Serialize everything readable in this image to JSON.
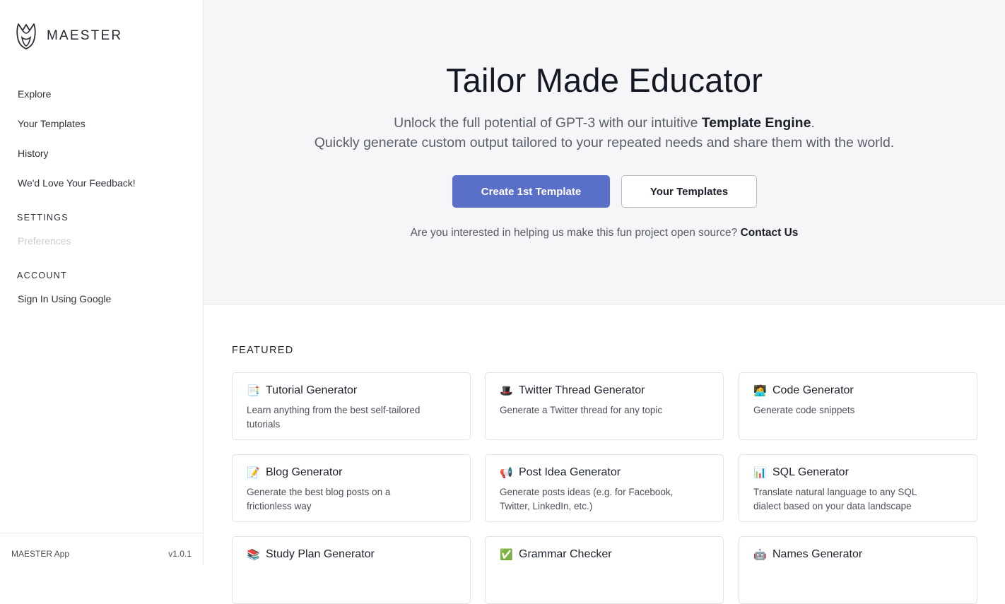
{
  "sidebar": {
    "brand": "MAESTER",
    "nav": [
      {
        "label": "Explore"
      },
      {
        "label": "Your Templates"
      },
      {
        "label": "History"
      },
      {
        "label": "We'd Love Your Feedback!"
      }
    ],
    "settings_title": "SETTINGS",
    "settings_items": [
      {
        "label": "Preferences",
        "disabled": true
      }
    ],
    "account_title": "ACCOUNT",
    "account_items": [
      {
        "label": "Sign In Using Google"
      }
    ],
    "footer": {
      "app_name": "MAESTER App",
      "version": "v1.0.1"
    }
  },
  "hero": {
    "title": "Tailor Made Educator",
    "subtitle_prefix": "Unlock the full potential of GPT-3 with our intuitive ",
    "subtitle_bold": "Template Engine",
    "subtitle_suffix": ".",
    "subtitle_line2": "Quickly generate custom output tailored to your repeated needs and share them with the world.",
    "primary_button": "Create 1st Template",
    "secondary_button": "Your Templates",
    "contact_text": "Are you interested in helping us make this fun project open source?",
    "contact_link": "Contact Us"
  },
  "featured": {
    "title": "FEATURED",
    "cards": [
      {
        "icon": "page-icon",
        "title": "Tutorial Generator",
        "description": "Learn anything from the best self-tailored tutorials"
      },
      {
        "icon": "top-hat-icon",
        "title": "Twitter Thread Generator",
        "description": "Generate a Twitter thread for any topic"
      },
      {
        "icon": "technologist-icon",
        "title": "Code Generator",
        "description": "Generate code snippets"
      },
      {
        "icon": "memo-icon",
        "title": "Blog Generator",
        "description": "Generate the best blog posts on a frictionless way"
      },
      {
        "icon": "megaphone-icon",
        "title": "Post Idea Generator",
        "description": "Generate posts ideas (e.g. for Facebook, Twitter, LinkedIn, etc.)"
      },
      {
        "icon": "bar-chart-icon",
        "title": "SQL Generator",
        "description": "Translate natural language to any SQL dialect based on your data landscape"
      },
      {
        "icon": "books-icon",
        "title": "Study Plan Generator",
        "description": ""
      },
      {
        "icon": "check-mark-icon",
        "title": "Grammar Checker",
        "description": ""
      },
      {
        "icon": "robot-face-icon",
        "title": "Names Generator",
        "description": ""
      }
    ]
  },
  "colors": {
    "accent": "#5a6fc8",
    "hero_bg": "#f6f6f9",
    "border": "#e1e2e7"
  }
}
